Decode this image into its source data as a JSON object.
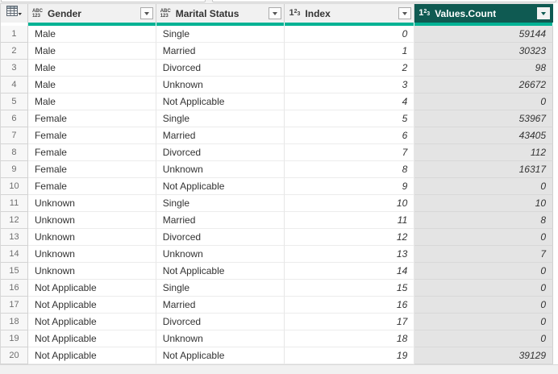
{
  "formula_bar": {
    "note": "only bottom edge of two toolbar boxes visible"
  },
  "grid": {
    "corner_menu": {
      "icon": "table-grid-icon"
    },
    "columns": [
      {
        "name": "Gender",
        "data_type": "text",
        "selected": false
      },
      {
        "name": "Marital Status",
        "data_type": "text",
        "selected": false
      },
      {
        "name": "Index",
        "data_type": "whole-number",
        "selected": false
      },
      {
        "name": "Values.Count",
        "data_type": "whole-number",
        "selected": true
      }
    ],
    "rows": [
      [
        "1",
        "Male",
        "Single",
        "0",
        "59144"
      ],
      [
        "2",
        "Male",
        "Married",
        "1",
        "30323"
      ],
      [
        "3",
        "Male",
        "Divorced",
        "2",
        "98"
      ],
      [
        "4",
        "Male",
        "Unknown",
        "3",
        "26672"
      ],
      [
        "5",
        "Male",
        "Not Applicable",
        "4",
        "0"
      ],
      [
        "6",
        "Female",
        "Single",
        "5",
        "53967"
      ],
      [
        "7",
        "Female",
        "Married",
        "6",
        "43405"
      ],
      [
        "8",
        "Female",
        "Divorced",
        "7",
        "112"
      ],
      [
        "9",
        "Female",
        "Unknown",
        "8",
        "16317"
      ],
      [
        "10",
        "Female",
        "Not Applicable",
        "9",
        "0"
      ],
      [
        "11",
        "Unknown",
        "Single",
        "10",
        "10"
      ],
      [
        "12",
        "Unknown",
        "Married",
        "11",
        "8"
      ],
      [
        "13",
        "Unknown",
        "Divorced",
        "12",
        "0"
      ],
      [
        "14",
        "Unknown",
        "Unknown",
        "13",
        "7"
      ],
      [
        "15",
        "Unknown",
        "Not Applicable",
        "14",
        "0"
      ],
      [
        "16",
        "Not Applicable",
        "Single",
        "15",
        "0"
      ],
      [
        "17",
        "Not Applicable",
        "Married",
        "16",
        "0"
      ],
      [
        "18",
        "Not Applicable",
        "Divorced",
        "17",
        "0"
      ],
      [
        "19",
        "Not Applicable",
        "Unknown",
        "18",
        "0"
      ],
      [
        "20",
        "Not Applicable",
        "Not Applicable",
        "19",
        "39129"
      ]
    ]
  },
  "icons": {
    "text_type": {
      "line1": "ABC",
      "line2": "123"
    },
    "number_type": {
      "base": "1",
      "sup": "2",
      "sub": "3"
    },
    "filter": "dropdown-arrow",
    "corner": "table-grid-with-caret"
  },
  "colors": {
    "accent_underline": "#00b294",
    "selected_header_bg": "#0f5a52",
    "selected_column_bg": "#e4e4e4",
    "header_bg": "#f1f1f1"
  }
}
